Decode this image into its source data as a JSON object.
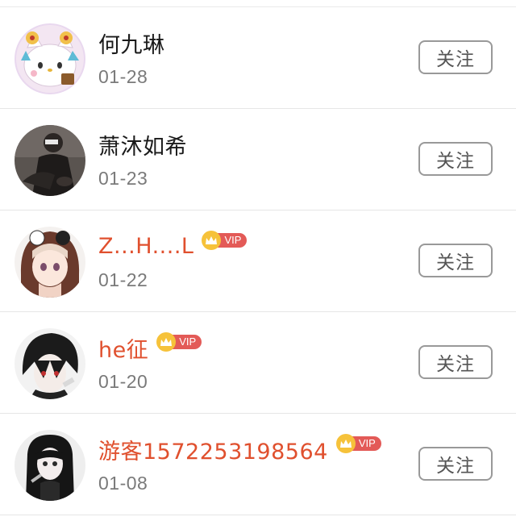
{
  "follow_list": [
    {
      "name": "何九琳",
      "date": "01-28",
      "vip": false,
      "follow_label": "关注",
      "avatar_icon": "hello-kitty-avatar-icon"
    },
    {
      "name": "萧沐如希",
      "date": "01-23",
      "vip": false,
      "follow_label": "关注",
      "avatar_icon": "dark-photo-avatar-icon"
    },
    {
      "name": "Z...H....L",
      "date": "01-22",
      "vip": true,
      "vip_label": "VIP",
      "follow_label": "关注",
      "avatar_icon": "anime-girl-avatar-icon"
    },
    {
      "name": "he征",
      "date": "01-20",
      "vip": true,
      "vip_label": "VIP",
      "follow_label": "关注",
      "avatar_icon": "anime-boy-avatar-icon"
    },
    {
      "name": "游客1572253198564",
      "date": "01-08",
      "vip": true,
      "vip_label": "VIP",
      "follow_label": "关注",
      "avatar_icon": "dark-hair-girl-avatar-icon"
    }
  ],
  "colors": {
    "vip_name": "#e0502e",
    "vip_tag": "#e35a57",
    "crown": "#f6c23a",
    "button_border": "#999999",
    "date": "#7a7a7a"
  }
}
